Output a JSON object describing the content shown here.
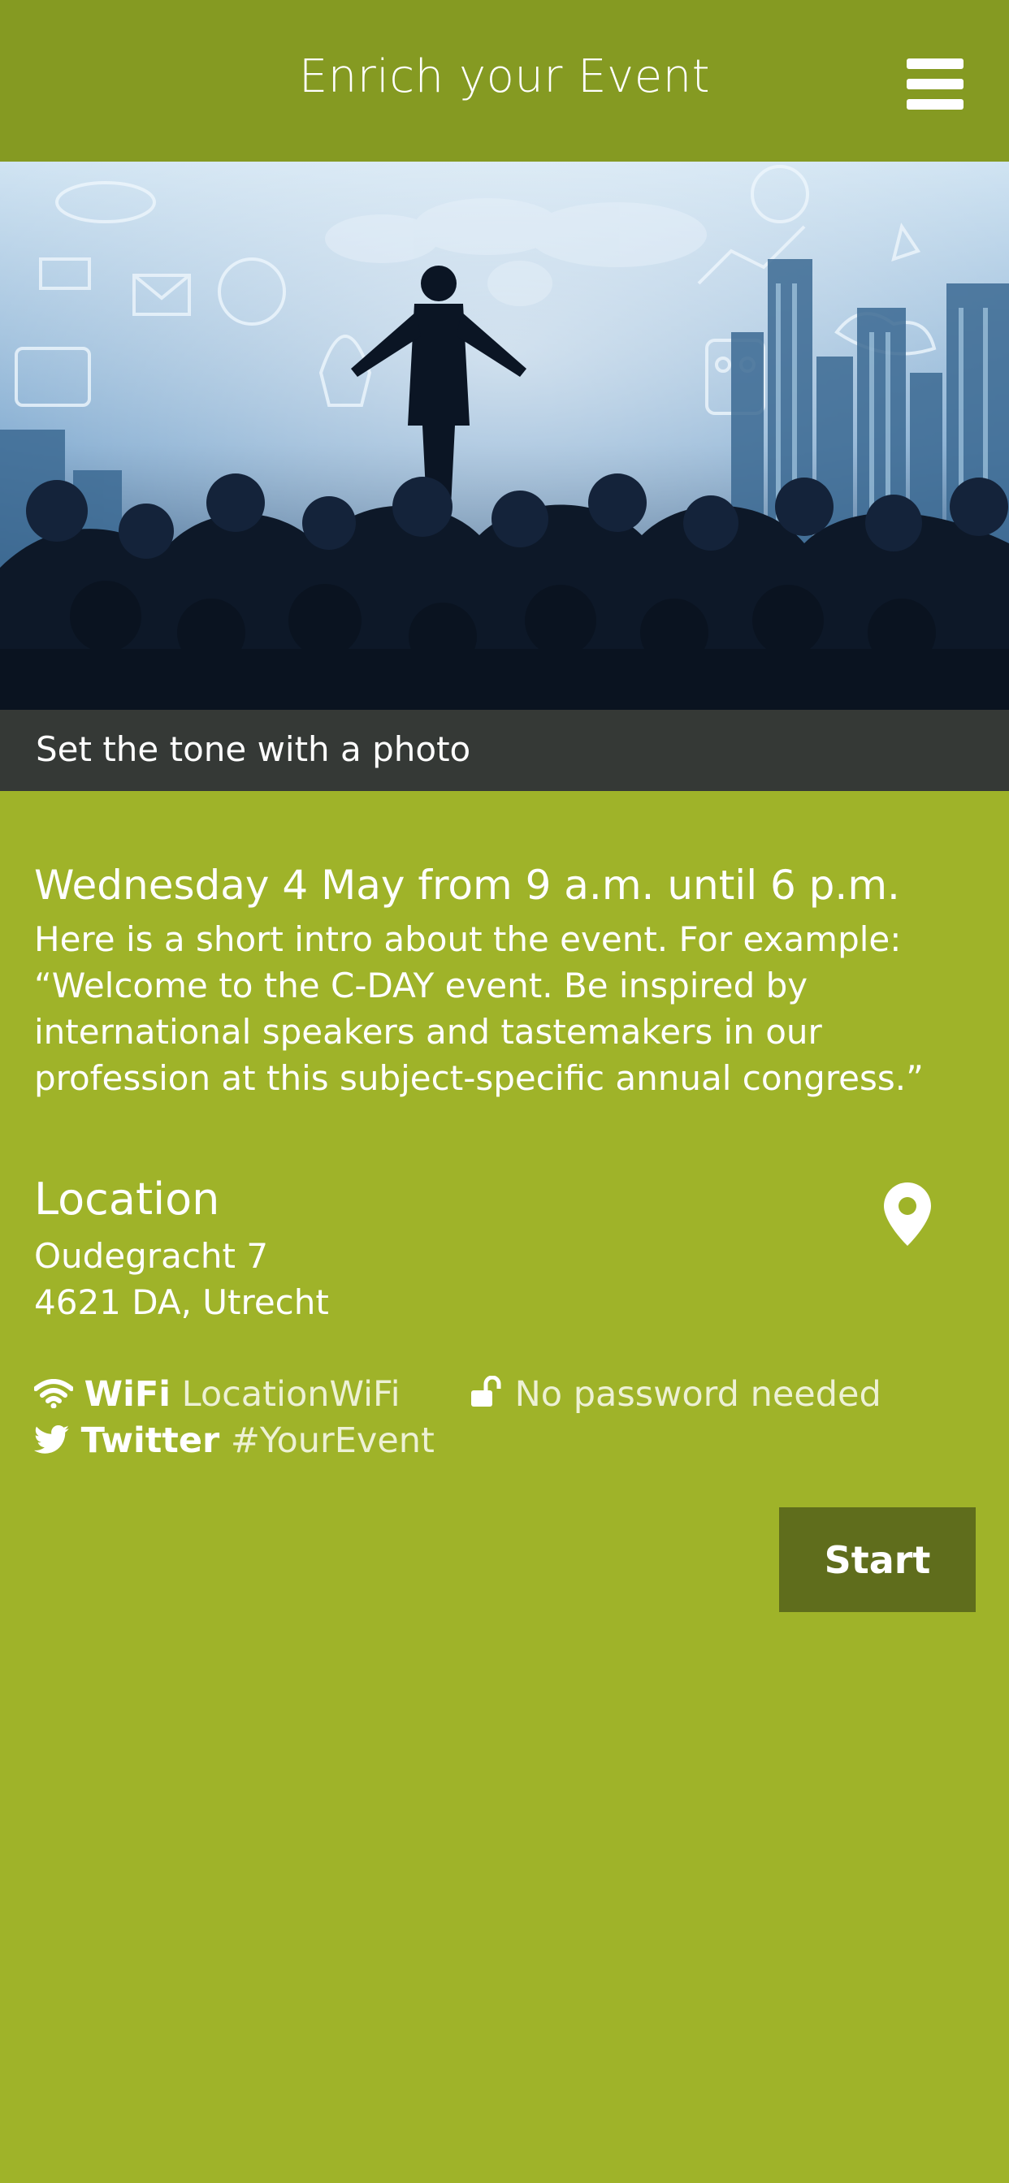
{
  "header": {
    "title": "Enrich your Event",
    "menu_icon": "hamburger-menu-icon"
  },
  "hero": {
    "caption": "Set the tone with a photo"
  },
  "event": {
    "date_line": "Wednesday 4 May from 9 a.m. until 6 p.m.",
    "intro": "Here is a short intro about the event. For example: “Welcome to the C-DAY event. Be inspired by international speakers and tastemakers in our profession at this subject-specific annual congress.”"
  },
  "location": {
    "heading": "Location",
    "address_line1": "Oudegracht 7",
    "address_line2": "4621 DA, Utrecht",
    "pin_icon": "map-pin-icon"
  },
  "wifi": {
    "icon": "wifi-icon",
    "label": "WiFi",
    "network": "LocationWiFi",
    "lock_icon": "unlocked-padlock-icon",
    "password_note": "No password needed"
  },
  "twitter": {
    "icon": "twitter-bird-icon",
    "label": "Twitter",
    "hashtag": "#YourEvent"
  },
  "actions": {
    "start_label": "Start"
  },
  "colors": {
    "header_bg": "#859a22",
    "page_bg": "#9fb329",
    "button_bg": "#5f6d1c",
    "text": "#ffffff"
  }
}
